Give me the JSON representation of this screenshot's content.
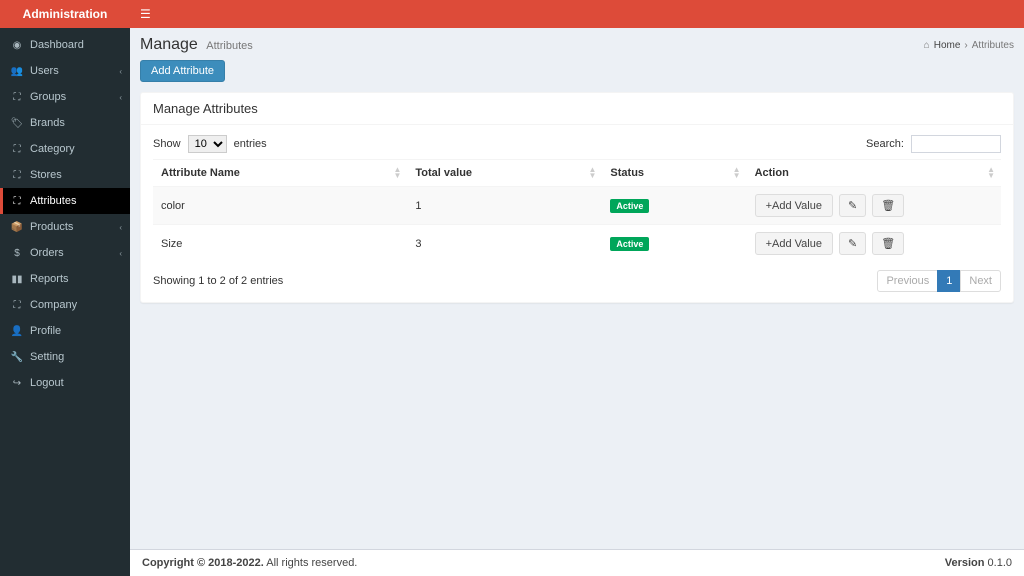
{
  "brand": "Administration",
  "sidebar": {
    "items": [
      {
        "label": "Dashboard",
        "icon": "◉",
        "expandable": false,
        "active": false
      },
      {
        "label": "Users",
        "icon": "👥",
        "expandable": true,
        "active": false
      },
      {
        "label": "Groups",
        "icon": "⛶",
        "expandable": true,
        "active": false
      },
      {
        "label": "Brands",
        "icon": "🏷",
        "expandable": false,
        "active": false
      },
      {
        "label": "Category",
        "icon": "⛶",
        "expandable": false,
        "active": false
      },
      {
        "label": "Stores",
        "icon": "⛶",
        "expandable": false,
        "active": false
      },
      {
        "label": "Attributes",
        "icon": "⛶",
        "expandable": false,
        "active": true
      },
      {
        "label": "Products",
        "icon": "📦",
        "expandable": true,
        "active": false
      },
      {
        "label": "Orders",
        "icon": "$",
        "expandable": true,
        "active": false
      },
      {
        "label": "Reports",
        "icon": "▮▮",
        "expandable": false,
        "active": false
      },
      {
        "label": "Company",
        "icon": "⛶",
        "expandable": false,
        "active": false
      },
      {
        "label": "Profile",
        "icon": "👤",
        "expandable": false,
        "active": false
      },
      {
        "label": "Setting",
        "icon": "🔧",
        "expandable": false,
        "active": false
      },
      {
        "label": "Logout",
        "icon": "↪",
        "expandable": false,
        "active": false
      }
    ]
  },
  "page": {
    "title": "Manage",
    "subtitle": "Attributes",
    "breadcrumb_home": "Home",
    "breadcrumb_current": "Attributes",
    "add_button": "Add Attribute"
  },
  "panel": {
    "title": "Manage Attributes"
  },
  "datatable": {
    "show_label_pre": "Show",
    "show_label_post": "entries",
    "length_value": "10",
    "search_label": "Search:",
    "search_value": "",
    "columns": [
      "Attribute Name",
      "Total value",
      "Status",
      "Action"
    ],
    "rows": [
      {
        "name": "color",
        "total": "1",
        "status": "Active"
      },
      {
        "name": "Size",
        "total": "3",
        "status": "Active"
      }
    ],
    "add_value_label": "Add Value",
    "info": "Showing 1 to 2 of 2 entries",
    "pagination": {
      "prev": "Previous",
      "pages": [
        "1"
      ],
      "next": "Next",
      "active": "1"
    }
  },
  "footer": {
    "copyright_strong": "Copyright © 2018-2022.",
    "copyright_rest": " All rights reserved.",
    "version_label": "Version ",
    "version": "0.1.0"
  }
}
